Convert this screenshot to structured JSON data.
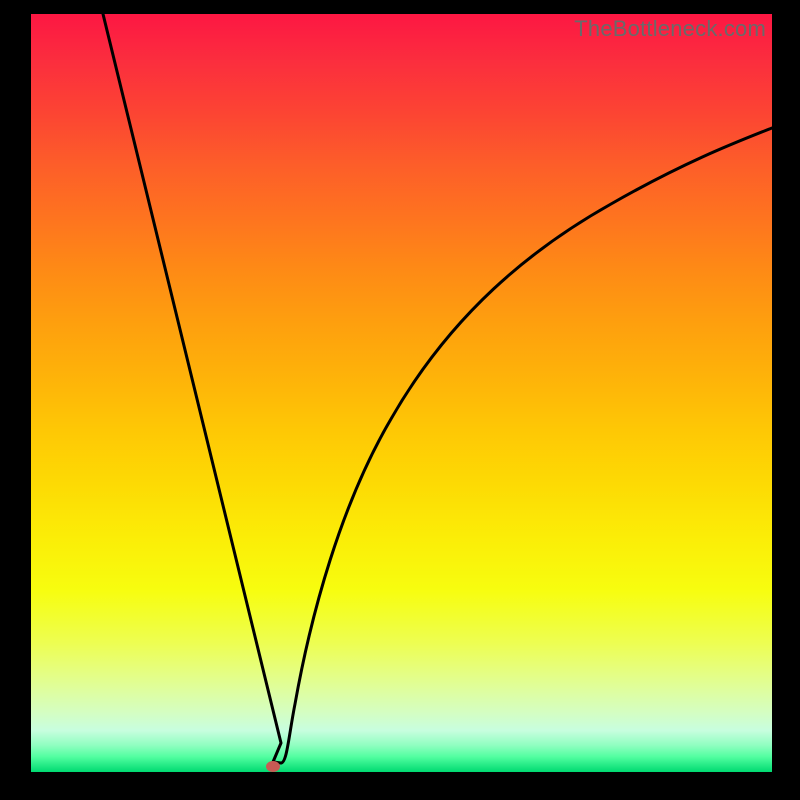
{
  "watermark": "TheBottleneck.com",
  "colors": {
    "background": "#000000",
    "curve_stroke": "#000000",
    "dot_fill": "#c85a54"
  },
  "chart_data": {
    "type": "line",
    "title": "",
    "xlabel": "",
    "ylabel": "",
    "xlim": [
      0,
      100
    ],
    "ylim": [
      0,
      100
    ],
    "grid": false,
    "legend": false,
    "annotations": [
      {
        "text": "TheBottleneck.com",
        "position": "top-right"
      }
    ],
    "marker": {
      "x": 32.6,
      "y": 1.1
    },
    "series": [
      {
        "name": "left-branch",
        "x": [
          9.7,
          12,
          15,
          18,
          21,
          24,
          27,
          29,
          30.5,
          31.5,
          32.6,
          33.7
        ],
        "y": [
          100,
          90.5,
          78.2,
          65.9,
          53.6,
          41.2,
          28.9,
          20.6,
          14.2,
          9.5,
          1.9,
          1.2
        ]
      },
      {
        "name": "right-branch",
        "x": [
          33.7,
          35,
          37,
          40,
          44,
          50,
          56,
          62,
          70,
          78,
          86,
          94,
          100
        ],
        "y": [
          1.2,
          8.6,
          19.1,
          31.6,
          43.5,
          55.3,
          62.9,
          68.5,
          73.9,
          77.8,
          80.9,
          83.4,
          85.0
        ]
      }
    ]
  }
}
